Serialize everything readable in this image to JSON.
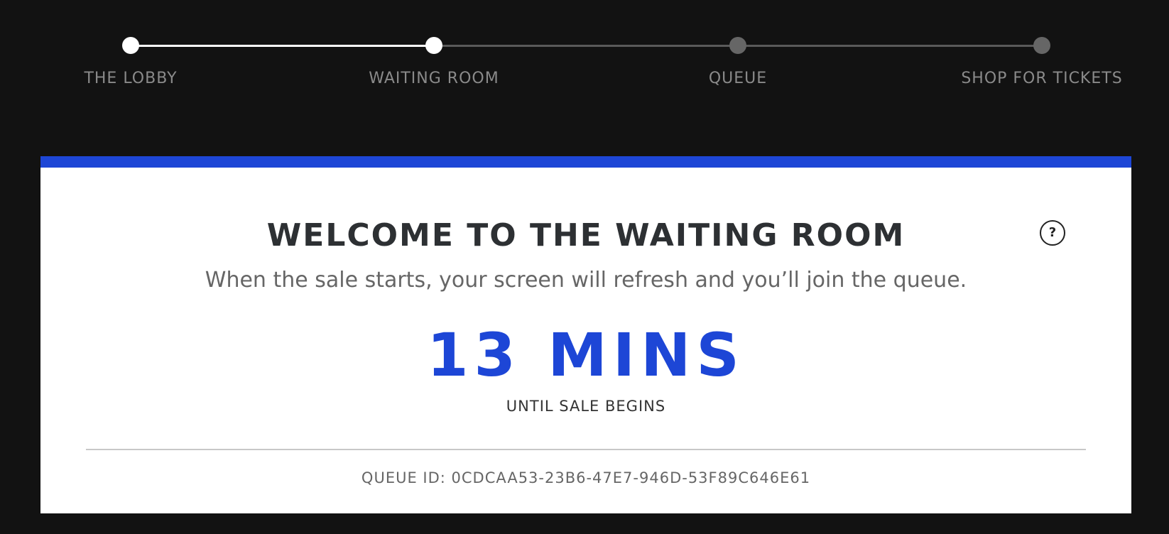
{
  "progress": {
    "steps": [
      {
        "label": "THE LOBBY",
        "completed": true
      },
      {
        "label": "WAITING ROOM",
        "completed": true
      },
      {
        "label": "QUEUE",
        "completed": false
      },
      {
        "label": "SHOP FOR TICKETS",
        "completed": false
      }
    ]
  },
  "card": {
    "accent_color": "#1d46d6",
    "title": "WELCOME TO THE WAITING ROOM",
    "subtitle": "When the sale starts, your screen will refresh and you’ll join the queue.",
    "countdown": "13 MINS",
    "countdown_caption": "UNTIL SALE BEGINS",
    "queue_id": "QUEUE ID: 0CDCAA53-23B6-47E7-946D-53F89C646E61",
    "help_icon": "?"
  }
}
